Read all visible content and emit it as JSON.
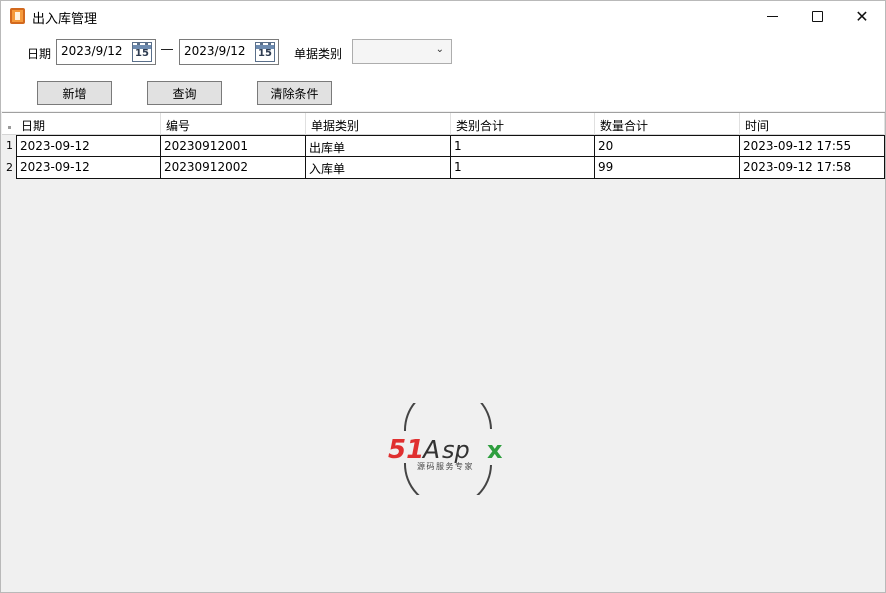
{
  "window": {
    "title": "出入库管理"
  },
  "filters": {
    "date_label": "日期",
    "date_from": "2023/9/12",
    "date_to": "2023/9/12",
    "date_separator": "—",
    "calendar_day": "15",
    "type_label": "单据类别",
    "type_value": "",
    "type_chevron": "⌄"
  },
  "buttons": {
    "add": "新增",
    "query": "查询",
    "clear": "清除条件"
  },
  "table": {
    "columns": [
      "日期",
      "编号",
      "单据类别",
      "类别合计",
      "数量合计",
      "时间"
    ],
    "rows": [
      {
        "index": "1",
        "cells": [
          "2023-09-12",
          "20230912001",
          "出库单",
          "1",
          "20",
          "2023-09-12 17:55"
        ]
      },
      {
        "index": "2",
        "cells": [
          "2023-09-12",
          "20230912002",
          "入库单",
          "1",
          "99",
          "2023-09-12 17:58"
        ]
      }
    ]
  },
  "watermark": {
    "brand_51": "51",
    "brand_a": "A",
    "brand_sp": "sp",
    "brand_x": "x",
    "tagline": "源码服务专家",
    "colors": {
      "red": "#e03030",
      "dark": "#333333",
      "green": "#2e9e3e"
    }
  }
}
